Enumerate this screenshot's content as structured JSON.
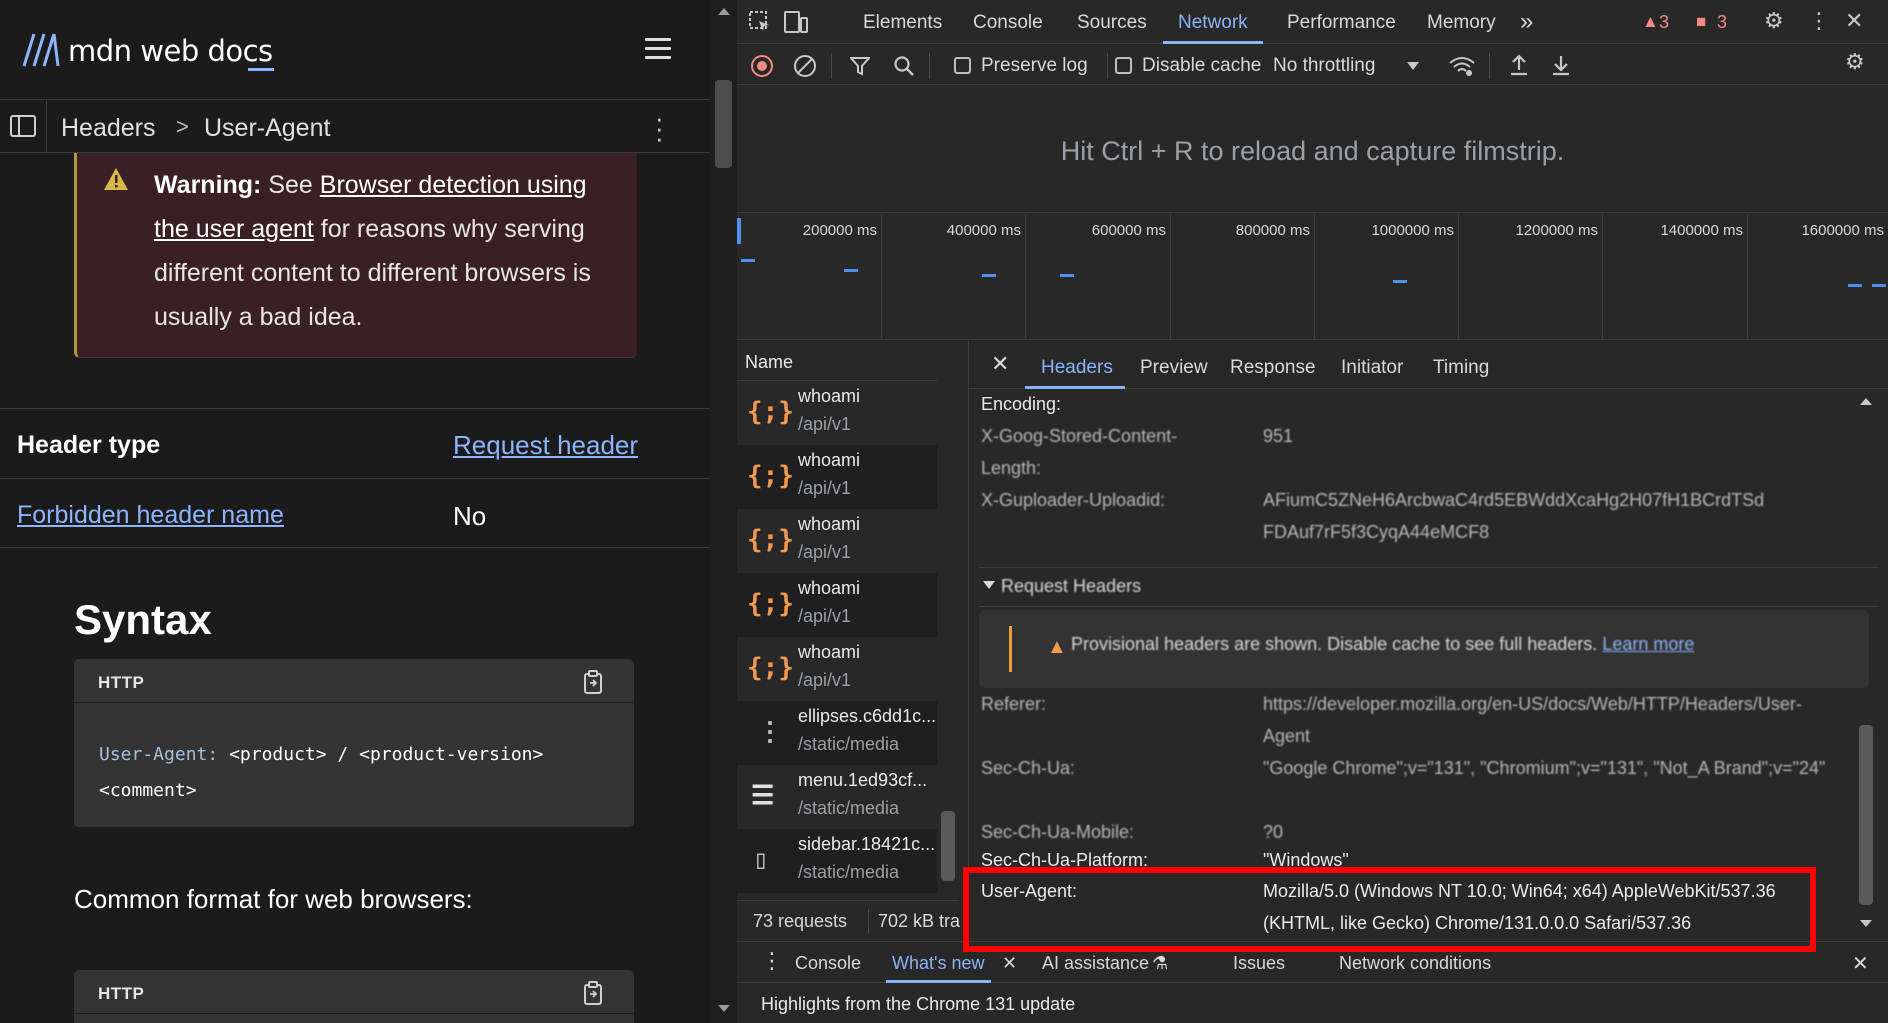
{
  "mdn": {
    "logo_text": "mdn web docs",
    "breadcrumb": {
      "parent": "Headers",
      "separator": ">",
      "current": "User-Agent"
    },
    "warning": {
      "label": "Warning:",
      "pre": "See",
      "link": "Browser detection using the user agent",
      "post": "for reasons why serving different content to different browsers is usually a bad idea."
    },
    "spec_table": {
      "header_type_label": "Header type",
      "header_type_value": "Request header",
      "forbidden_label": "Forbidden header name",
      "forbidden_value": "No"
    },
    "syntax_heading": "Syntax",
    "code_lang": "HTTP",
    "code_line1_key": "User-Agent:",
    "code_line1_rest": "<product> / <product-version>",
    "code_line2": "<comment>",
    "common_format": "Common format for web browsers:",
    "code2_lang": "HTTP"
  },
  "devtools": {
    "tabs": [
      "Elements",
      "Console",
      "Sources",
      "Network",
      "Performance",
      "Memory"
    ],
    "more_tabs": "»",
    "warnings_count": "3",
    "errors_count": "3",
    "toolbar": {
      "preserve_log": "Preserve log",
      "disable_cache": "Disable cache",
      "throttling": "No throttling"
    },
    "filmstrip_hint": "Hit Ctrl + R to reload and capture filmstrip.",
    "timeline_labels": [
      "200000 ms",
      "400000 ms",
      "600000 ms",
      "800000 ms",
      "1000000 ms",
      "1200000 ms",
      "1400000 ms",
      "1600000 ms"
    ],
    "request_list": {
      "column": "Name",
      "rows": [
        {
          "name": "whoami",
          "path": "/api/v1",
          "icon": "{;}"
        },
        {
          "name": "whoami",
          "path": "/api/v1",
          "icon": "{;}"
        },
        {
          "name": "whoami",
          "path": "/api/v1",
          "icon": "{;}"
        },
        {
          "name": "whoami",
          "path": "/api/v1",
          "icon": "{;}"
        },
        {
          "name": "whoami",
          "path": "/api/v1",
          "icon": "{;}"
        },
        {
          "name": "ellipses.c6dd1c...",
          "path": "/static/media",
          "icon": "⋮"
        },
        {
          "name": "menu.1ed93cf...",
          "path": "/static/media",
          "icon": "☰"
        },
        {
          "name": "sidebar.18421c...",
          "path": "/static/media",
          "icon": "▯"
        }
      ],
      "requests_count": "73 requests",
      "transferred": "702 kB tra"
    },
    "detail_tabs": [
      "Headers",
      "Preview",
      "Response",
      "Initiator",
      "Timing"
    ],
    "response_headers": [
      {
        "key": "Encoding:",
        "value": ""
      },
      {
        "key": "X-Goog-Stored-Content-",
        "value": "951"
      },
      {
        "key": "Length:",
        "value": ""
      },
      {
        "key": "X-Guploader-Uploadid:",
        "value": "AFiumC5ZNeH6ArcbwaC4rd5EBWddXcaHg2H07fH1BCrdTSd"
      },
      {
        "key": "",
        "value": "FDAuf7rF5f3CyqA44eMCF8"
      }
    ],
    "request_headers_title": "Request Headers",
    "provisional_text": "Provisional headers are shown. Disable cache to see full headers.",
    "provisional_link": "Learn more",
    "request_headers": [
      {
        "key": "Referer:",
        "value": "https://developer.mozilla.org/en-US/docs/Web/HTTP/Headers/User-Agent"
      },
      {
        "key": "Sec-Ch-Ua:",
        "value": "\"Google Chrome\";v=\"131\", \"Chromium\";v=\"131\", \"Not_A Brand\";v=\"24\""
      },
      {
        "key": "Sec-Ch-Ua-Mobile:",
        "value": "?0"
      },
      {
        "key": "Sec-Ch-Ua-Platform:",
        "value": "\"Windows\""
      }
    ],
    "user_agent": {
      "key": "User-Agent:",
      "value": "Mozilla/5.0 (Windows NT 10.0; Win64; x64) AppleWebKit/537.36 (KHTML, like Gecko) Chrome/131.0.0.0 Safari/537.36"
    },
    "drawer": {
      "tabs": [
        "Console",
        "What's new",
        "AI assistance",
        "Issues",
        "Network conditions"
      ],
      "content": "Highlights from the Chrome 131 update"
    },
    "colors": {
      "accent": "#8ab4f8",
      "highlight": "#ff0000",
      "warning": "#f28b82"
    }
  }
}
